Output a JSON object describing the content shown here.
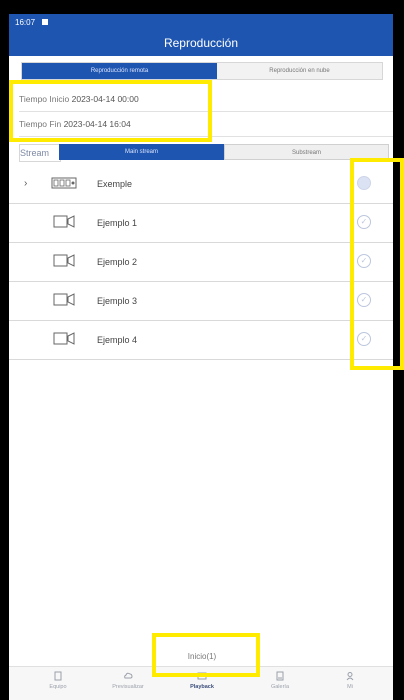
{
  "status": {
    "time": "16:07"
  },
  "header": {
    "title": "Reproducción"
  },
  "segment": {
    "left": "Reproducción remota",
    "right": "Reproducción en nube"
  },
  "time_fields": [
    {
      "label": "Tiempo Inicio",
      "value": "2023-04-14 00:00"
    },
    {
      "label": "Tiempo Fin",
      "value": "2023-04-14 16:04"
    }
  ],
  "stream": {
    "label": "Stream",
    "main": "Main stream",
    "sub": "Substream"
  },
  "devices": [
    {
      "name": "Exemple",
      "type": "nvr",
      "expand": "›"
    },
    {
      "name": "Ejemplo 1",
      "type": "camera"
    },
    {
      "name": "Ejemplo 2",
      "type": "camera"
    },
    {
      "name": "Ejemplo 3",
      "type": "camera"
    },
    {
      "name": "Ejemplo 4",
      "type": "camera"
    }
  ],
  "bottom": {
    "start_label": "Inicio(1)"
  },
  "tabbar": [
    {
      "label": "Equipo",
      "icon": "device-icon"
    },
    {
      "label": "Previsualizar",
      "icon": "cloud-icon"
    },
    {
      "label": "Playback",
      "icon": "playback-icon"
    },
    {
      "label": "Galería",
      "icon": "gallery-icon"
    },
    {
      "label": "Mi",
      "icon": "profile-icon"
    }
  ],
  "colors": {
    "primary": "#1e55b0",
    "highlight": "#ffeb00"
  }
}
